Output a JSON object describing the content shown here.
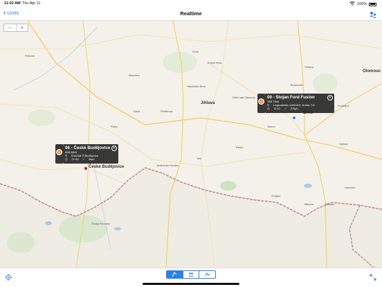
{
  "status": {
    "time": "11:02 AM",
    "date": "Thu Apr 11",
    "battery": "100%"
  },
  "nav": {
    "back_label": "Units",
    "title": "Realtime"
  },
  "map": {
    "zoom_out": "−",
    "zoom_in": "+",
    "cities": [
      "Brno",
      "Jihlava",
      "České Budějovice",
      "Olomouc"
    ],
    "places": [
      "Příbram",
      "Tábor",
      "Písek",
      "Pelhřimov",
      "Třebíč",
      "Znojmo",
      "Prostějov",
      "Vyškov",
      "Kolín",
      "Kutná Hora",
      "Havlíčkův Brod",
      "Český Krumlov",
      "Telč",
      "Blansko",
      "Boskovice",
      "Žďár nad Sázavou",
      "Hodonín",
      "Benešov",
      "Strakonice",
      "Jindřichův Hradec",
      "Mikulov",
      "Břeclav",
      "Svitavy",
      "Tišnov"
    ]
  },
  "units": [
    {
      "title": "06 - České Budějovice",
      "plate": "6B8 6843",
      "address": "EuroSat Č.Budějovice",
      "time": "07:43",
      "speed": "0kph",
      "marker_color": "#d0021b"
    },
    {
      "title": "00 - Stojan Ford Fusion",
      "plate": "7B5 7949",
      "address": "Legionářská 1085/422, Kuřim, CZ",
      "time": "11:01",
      "speed": "27kph",
      "marker_color": "#2f7fe0"
    }
  ],
  "colors": {
    "accent": "#2f7fe0",
    "border": "#c88a8a",
    "road": "#f5cf6a"
  }
}
